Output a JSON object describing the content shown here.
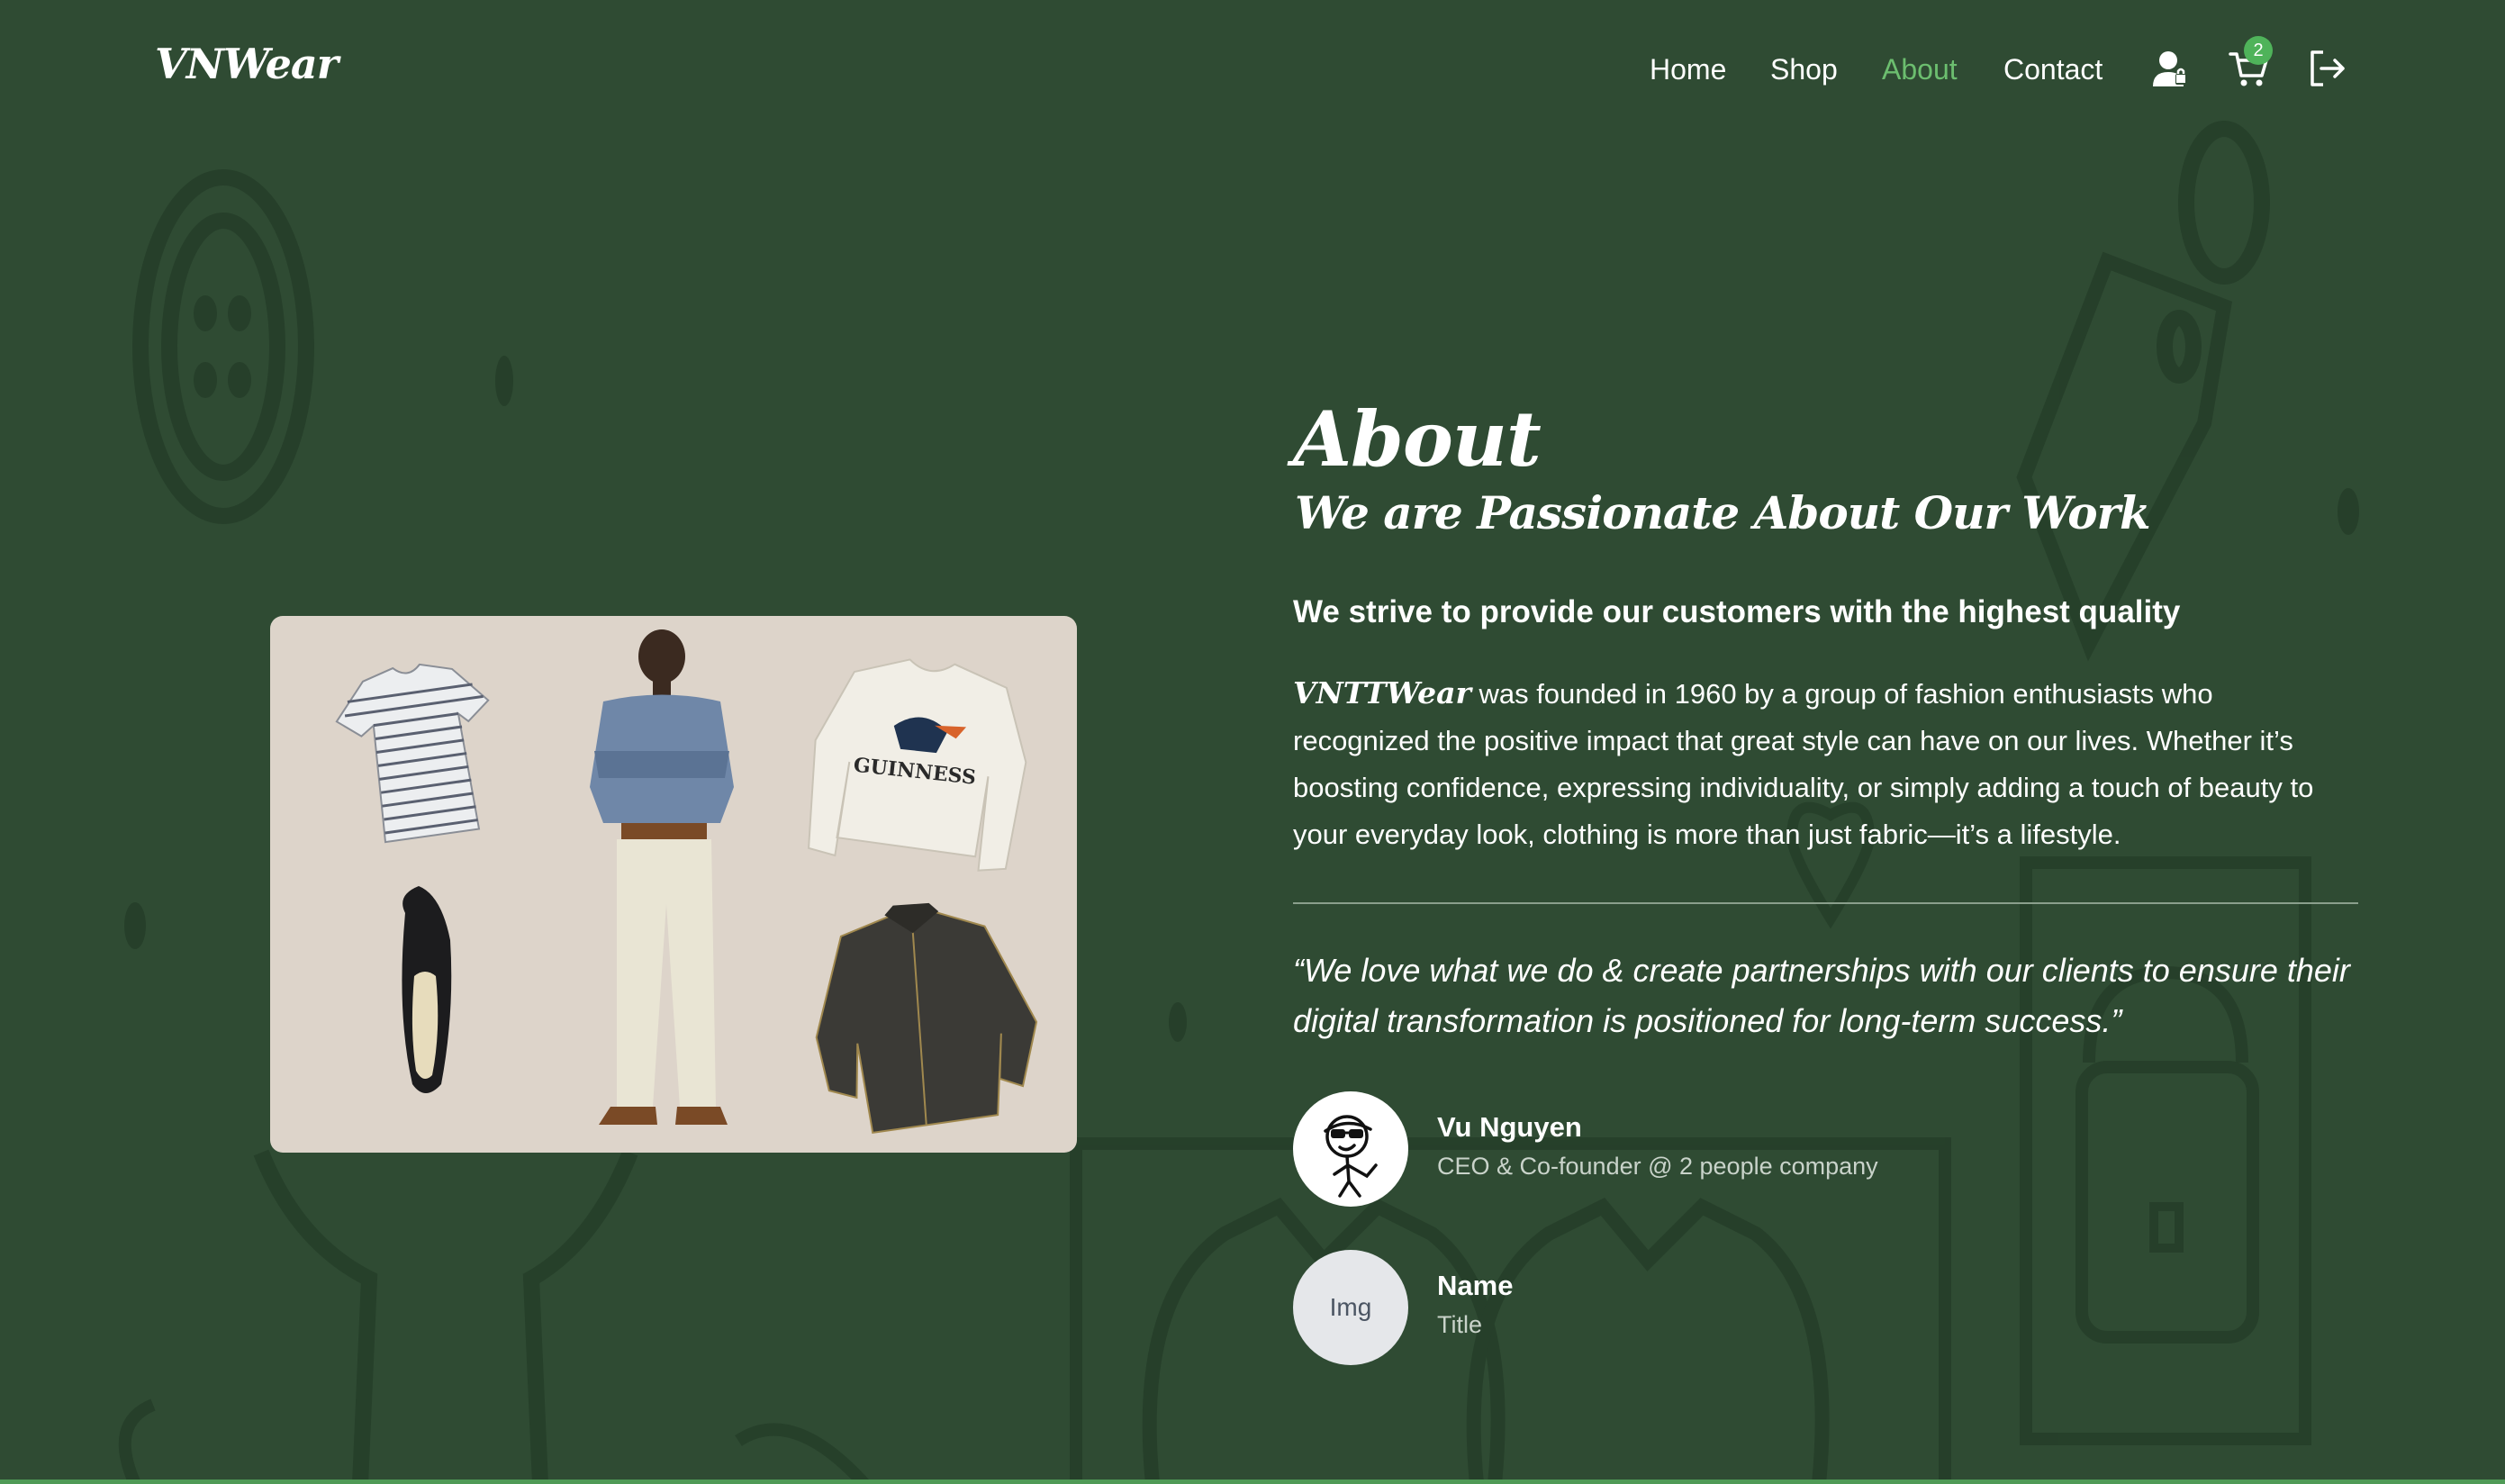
{
  "header": {
    "logo": "VNWear",
    "nav": [
      {
        "label": "Home",
        "active": false
      },
      {
        "label": "Shop",
        "active": false
      },
      {
        "label": "About",
        "active": true
      },
      {
        "label": "Contact",
        "active": false
      }
    ],
    "icons": [
      "user-icon",
      "cart-icon",
      "logout-icon"
    ],
    "cart_count": "2"
  },
  "about": {
    "title": "About",
    "subtitle": "We are Passionate About Our Work",
    "lead": "We strive to provide our customers with the highest quality",
    "brand_inline": "VNTTWear",
    "body": " was founded in 1960 by a group of fashion enthusiasts who recognized the positive impact that great style can have on our lives. Whether it’s boosting confidence, expressing individuality, or simply adding a touch of beauty to your everyday look, clothing is more than just fabric—it’s a lifestyle.",
    "quote": "“We love what we do & create partnerships with our clients to ensure their digital transformation is positioned for long-term success.”"
  },
  "people": [
    {
      "name": "Vu Nguyen",
      "title": "CEO & Co-founder @ 2 people company",
      "avatar": "stick-figure-avatar"
    },
    {
      "name": "Name",
      "title": "Title",
      "avatar_text": "Img"
    }
  ],
  "colors": {
    "background": "#2f4b33",
    "active_nav": "#6cbe6f",
    "badge": "#4fb35a",
    "photo_bg": "#ddd4ca"
  }
}
